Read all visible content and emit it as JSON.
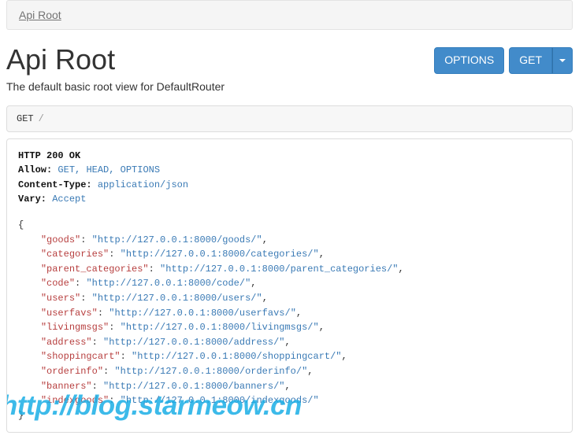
{
  "breadcrumb": {
    "label": "Api Root"
  },
  "title": "Api Root",
  "buttons": {
    "options": "OPTIONS",
    "get": "GET"
  },
  "description": "The default basic root view for DefaultRouter",
  "request": {
    "method": "GET",
    "path": "/"
  },
  "response": {
    "status": "HTTP 200 OK",
    "headers": {
      "allow_label": "Allow:",
      "allow_values": [
        "GET",
        "HEAD",
        "OPTIONS"
      ],
      "content_type_label": "Content-Type:",
      "content_type_value": "application/json",
      "vary_label": "Vary:",
      "vary_value": "Accept"
    },
    "body": [
      {
        "key": "goods",
        "url": "http://127.0.0.1:8000/goods/"
      },
      {
        "key": "categories",
        "url": "http://127.0.0.1:8000/categories/"
      },
      {
        "key": "parent_categories",
        "url": "http://127.0.0.1:8000/parent_categories/"
      },
      {
        "key": "code",
        "url": "http://127.0.0.1:8000/code/"
      },
      {
        "key": "users",
        "url": "http://127.0.0.1:8000/users/"
      },
      {
        "key": "userfavs",
        "url": "http://127.0.0.1:8000/userfavs/"
      },
      {
        "key": "livingmsgs",
        "url": "http://127.0.0.1:8000/livingmsgs/"
      },
      {
        "key": "address",
        "url": "http://127.0.0.1:8000/address/"
      },
      {
        "key": "shoppingcart",
        "url": "http://127.0.0.1:8000/shoppingcart/"
      },
      {
        "key": "orderinfo",
        "url": "http://127.0.0.1:8000/orderinfo/"
      },
      {
        "key": "banners",
        "url": "http://127.0.0.1:8000/banners/"
      },
      {
        "key": "indexgoods",
        "url": "http://127.0.0.1:8000/indexgoods/"
      }
    ]
  },
  "watermark": "http://blog.starmeow.cn"
}
